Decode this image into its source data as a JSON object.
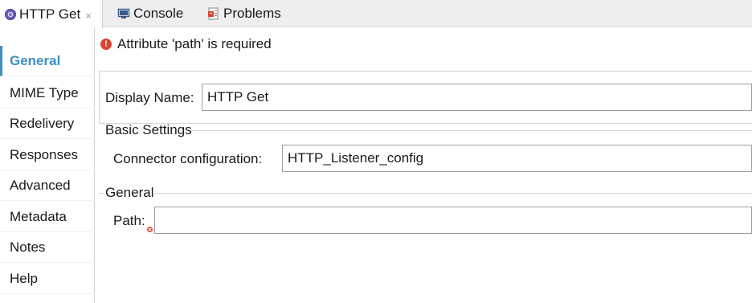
{
  "tabs": [
    {
      "label": "HTTP Get",
      "icon": "http-connector-icon",
      "active": true,
      "close": "×"
    },
    {
      "label": "Console",
      "icon": "console-icon",
      "active": false
    },
    {
      "label": "Problems",
      "icon": "problems-icon",
      "active": false
    }
  ],
  "sidebar": {
    "items": [
      {
        "label": "General",
        "selected": true
      },
      {
        "label": "MIME Type",
        "selected": false
      },
      {
        "label": "Redelivery",
        "selected": false
      },
      {
        "label": "Responses",
        "selected": false
      },
      {
        "label": "Advanced",
        "selected": false
      },
      {
        "label": "Metadata",
        "selected": false
      },
      {
        "label": "Notes",
        "selected": false
      },
      {
        "label": "Help",
        "selected": false
      }
    ]
  },
  "error": {
    "icon": "error-icon",
    "message": "Attribute 'path' is required"
  },
  "form": {
    "display_name_label": "Display Name:",
    "display_name_value": "HTTP Get",
    "basic_settings_title": "Basic Settings",
    "connector_config_label": "Connector configuration:",
    "connector_config_value": "HTTP_Listener_config",
    "general_title": "General",
    "path_label": "Path:",
    "path_value": ""
  },
  "colors": {
    "accent": "#3d8fc4",
    "error": "#d9452f",
    "tabbar_bg": "#eeeeee"
  }
}
